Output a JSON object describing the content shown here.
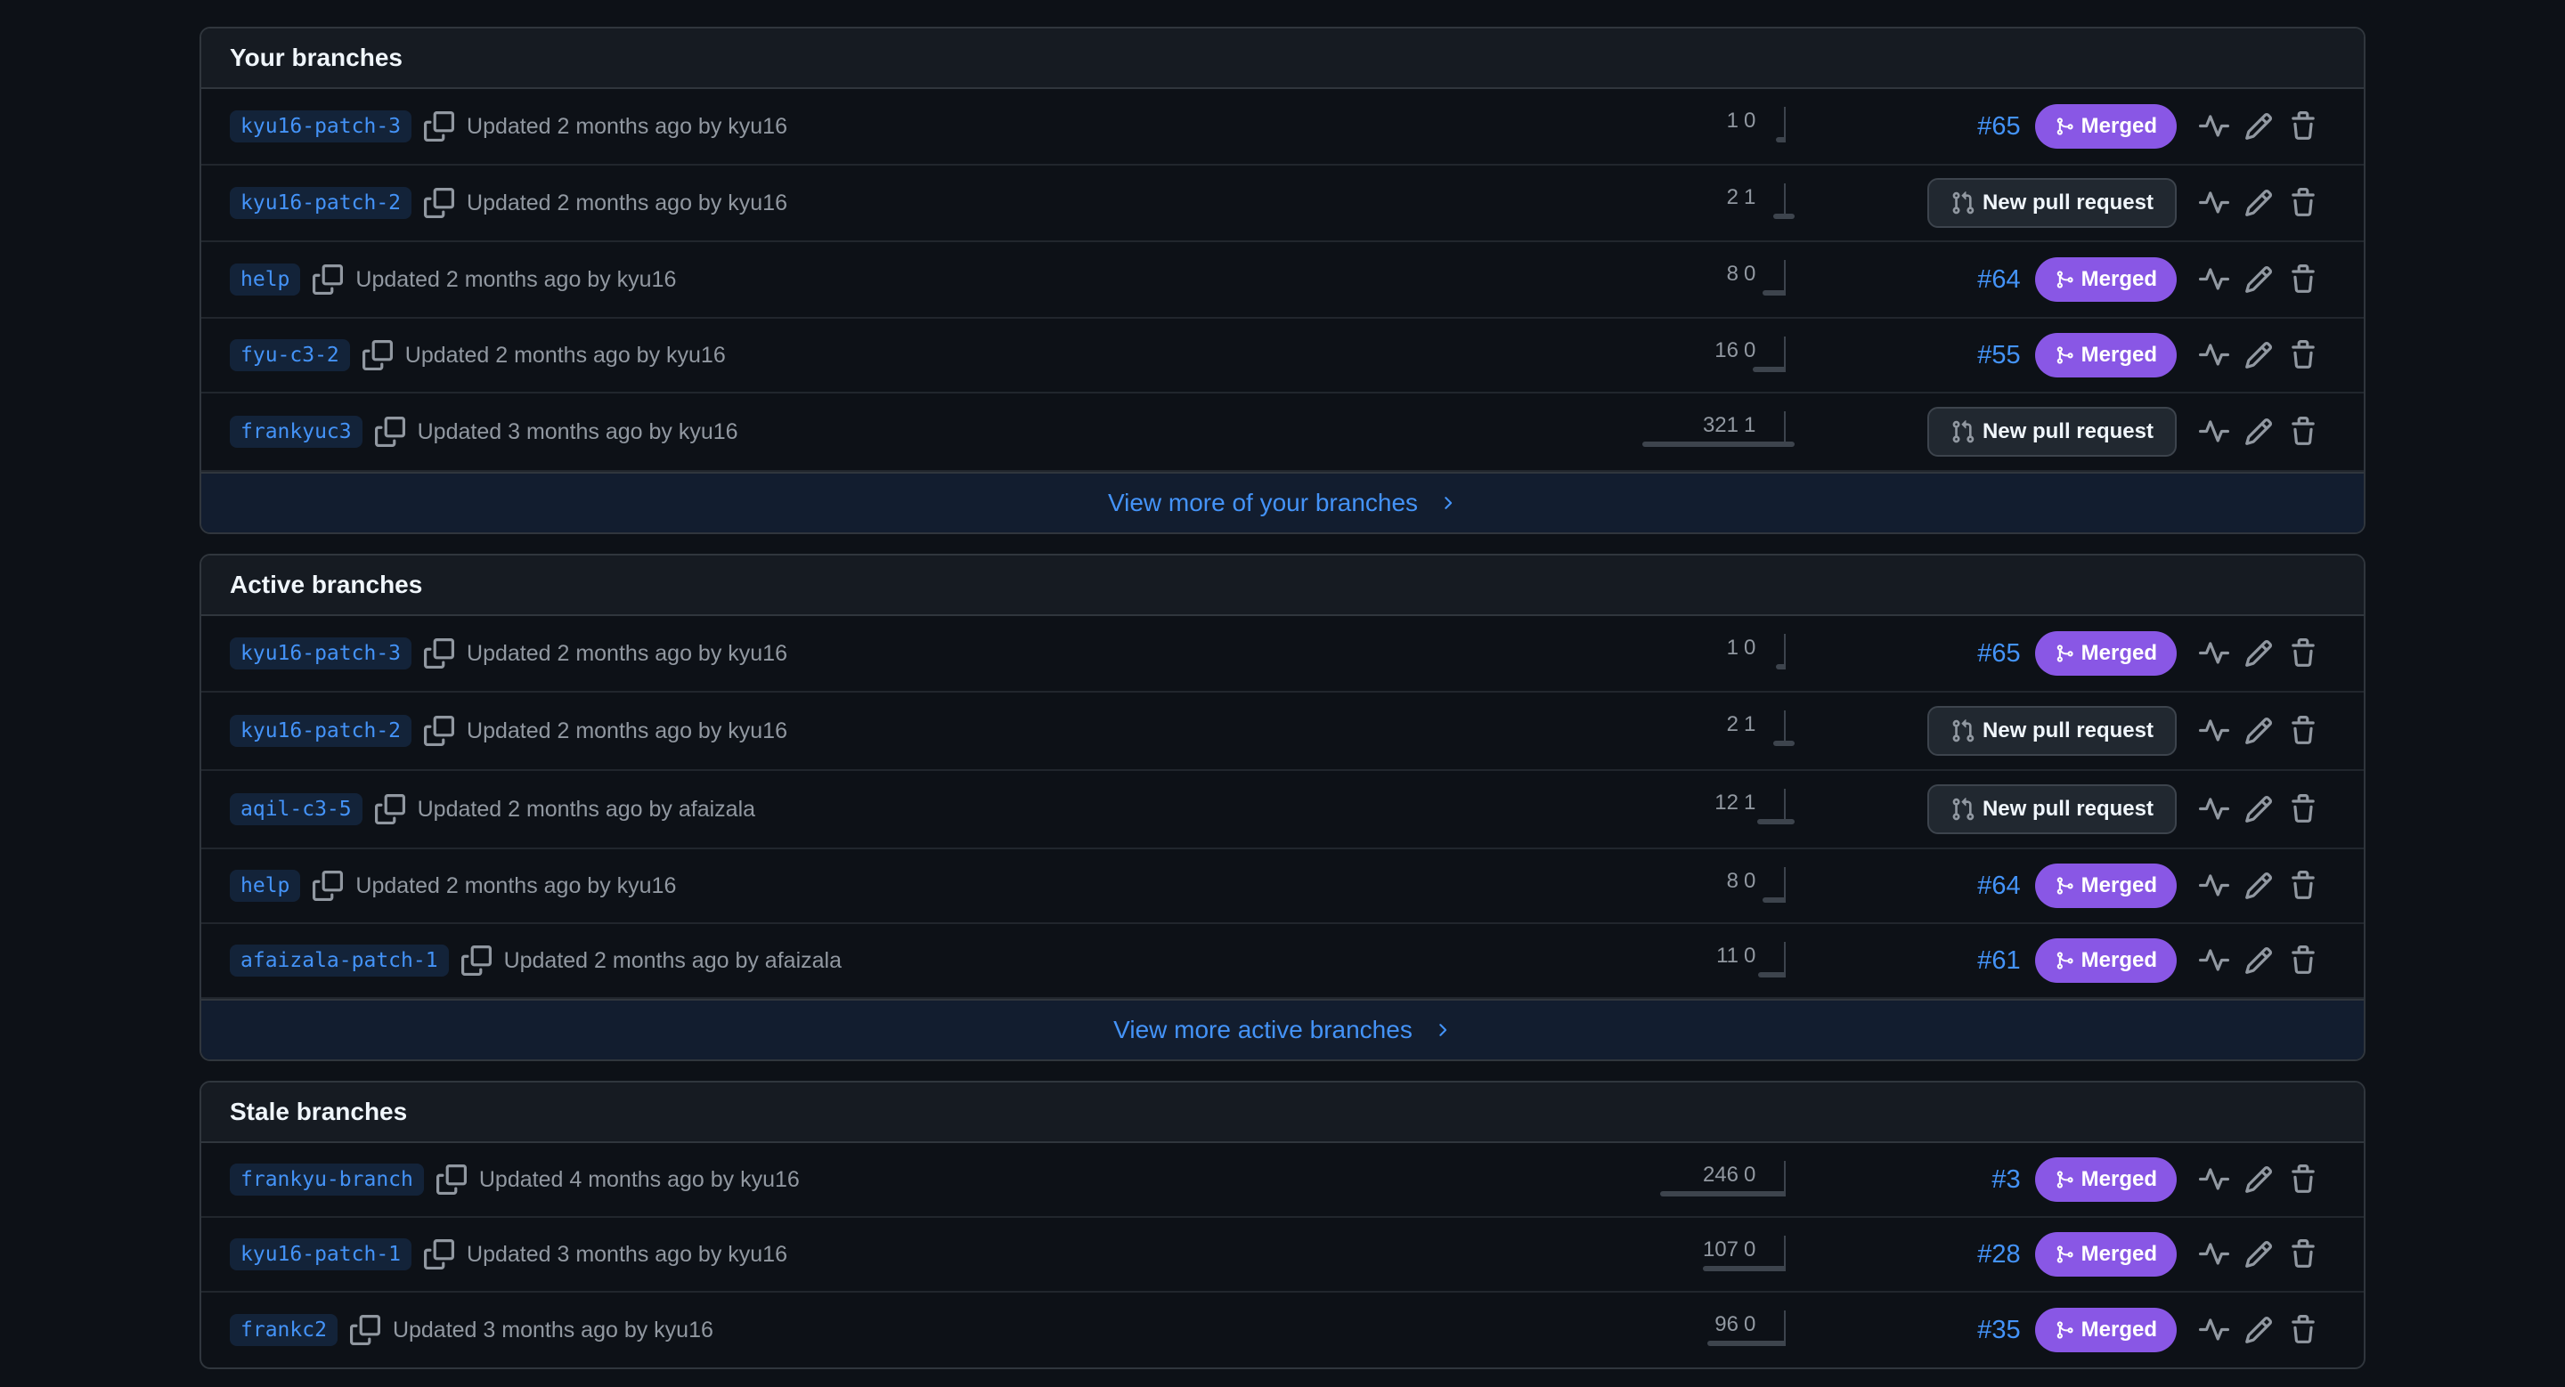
{
  "sections": [
    {
      "title": "Your branches",
      "view_more": "View more of your branches",
      "branches": [
        {
          "name": "kyu16-patch-3",
          "updated": "Updated 2 months ago by kyu16",
          "behind": "1",
          "ahead": "0",
          "pr": {
            "type": "merged",
            "number": "#65",
            "label": "Merged"
          }
        },
        {
          "name": "kyu16-patch-2",
          "updated": "Updated 2 months ago by kyu16",
          "behind": "2",
          "ahead": "1",
          "pr": {
            "type": "new",
            "label": "New pull request"
          }
        },
        {
          "name": "help",
          "updated": "Updated 2 months ago by kyu16",
          "behind": "8",
          "ahead": "0",
          "pr": {
            "type": "merged",
            "number": "#64",
            "label": "Merged"
          }
        },
        {
          "name": "fyu-c3-2",
          "updated": "Updated 2 months ago by kyu16",
          "behind": "16",
          "ahead": "0",
          "pr": {
            "type": "merged",
            "number": "#55",
            "label": "Merged"
          }
        },
        {
          "name": "frankyuc3",
          "updated": "Updated 3 months ago by kyu16",
          "behind": "321",
          "ahead": "1",
          "pr": {
            "type": "new",
            "label": "New pull request"
          }
        }
      ]
    },
    {
      "title": "Active branches",
      "view_more": "View more active branches",
      "branches": [
        {
          "name": "kyu16-patch-3",
          "updated": "Updated 2 months ago by kyu16",
          "behind": "1",
          "ahead": "0",
          "pr": {
            "type": "merged",
            "number": "#65",
            "label": "Merged"
          }
        },
        {
          "name": "kyu16-patch-2",
          "updated": "Updated 2 months ago by kyu16",
          "behind": "2",
          "ahead": "1",
          "pr": {
            "type": "new",
            "label": "New pull request"
          }
        },
        {
          "name": "aqil-c3-5",
          "updated": "Updated 2 months ago by afaizala",
          "behind": "12",
          "ahead": "1",
          "pr": {
            "type": "new",
            "label": "New pull request"
          }
        },
        {
          "name": "help",
          "updated": "Updated 2 months ago by kyu16",
          "behind": "8",
          "ahead": "0",
          "pr": {
            "type": "merged",
            "number": "#64",
            "label": "Merged"
          }
        },
        {
          "name": "afaizala-patch-1",
          "updated": "Updated 2 months ago by afaizala",
          "behind": "11",
          "ahead": "0",
          "pr": {
            "type": "merged",
            "number": "#61",
            "label": "Merged"
          }
        }
      ]
    },
    {
      "title": "Stale branches",
      "view_more": "",
      "branches": [
        {
          "name": "frankyu-branch",
          "updated": "Updated 4 months ago by kyu16",
          "behind": "246",
          "ahead": "0",
          "pr": {
            "type": "merged",
            "number": "#3",
            "label": "Merged"
          }
        },
        {
          "name": "kyu16-patch-1",
          "updated": "Updated 3 months ago by kyu16",
          "behind": "107",
          "ahead": "0",
          "pr": {
            "type": "merged",
            "number": "#28",
            "label": "Merged"
          }
        },
        {
          "name": "frankc2",
          "updated": "Updated 3 months ago by kyu16",
          "behind": "96",
          "ahead": "0",
          "pr": {
            "type": "merged",
            "number": "#35",
            "label": "Merged"
          }
        }
      ]
    }
  ],
  "icons": {
    "copy": "copy-icon",
    "activity": "activity-icon",
    "edit": "pencil-icon",
    "delete": "trash-icon",
    "merged": "git-merge-icon",
    "new_pr": "git-pull-request-icon",
    "chevron": "chevron-right-icon"
  },
  "colors": {
    "background": "#0d1117",
    "header_bg": "#161b22",
    "border": "#30363d",
    "link": "#4493f8",
    "merged": "#8957e5",
    "muted_text": "#9198a1",
    "view_more_bg": "#121d2f"
  }
}
